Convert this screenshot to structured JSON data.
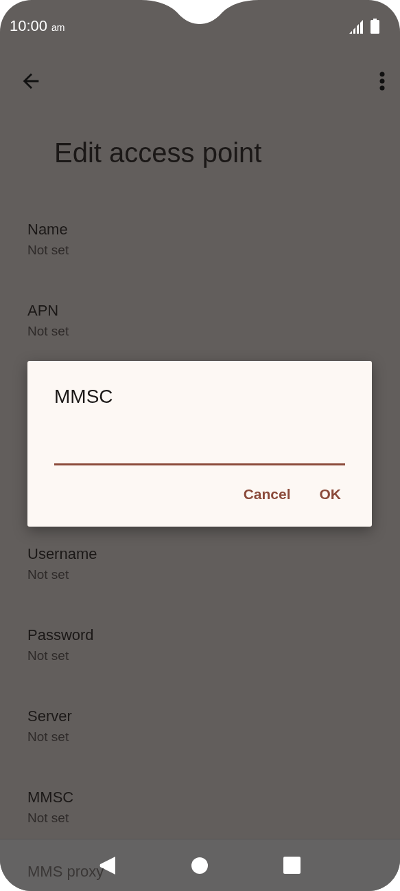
{
  "status_bar": {
    "time": "10:00",
    "period": "am"
  },
  "title": "Edit access point",
  "settings_above": [
    {
      "label": "Name",
      "value": "Not set"
    },
    {
      "label": "APN",
      "value": "Not set"
    }
  ],
  "settings_below": [
    {
      "label": "Username",
      "value": "Not set"
    },
    {
      "label": "Password",
      "value": "Not set"
    },
    {
      "label": "Server",
      "value": "Not set"
    },
    {
      "label": "MMSC",
      "value": "Not set"
    }
  ],
  "partly_hidden_setting": {
    "label": "MMS proxy"
  },
  "dialog": {
    "title": "MMSC",
    "buttons": [
      "Cancel",
      "OK"
    ]
  }
}
